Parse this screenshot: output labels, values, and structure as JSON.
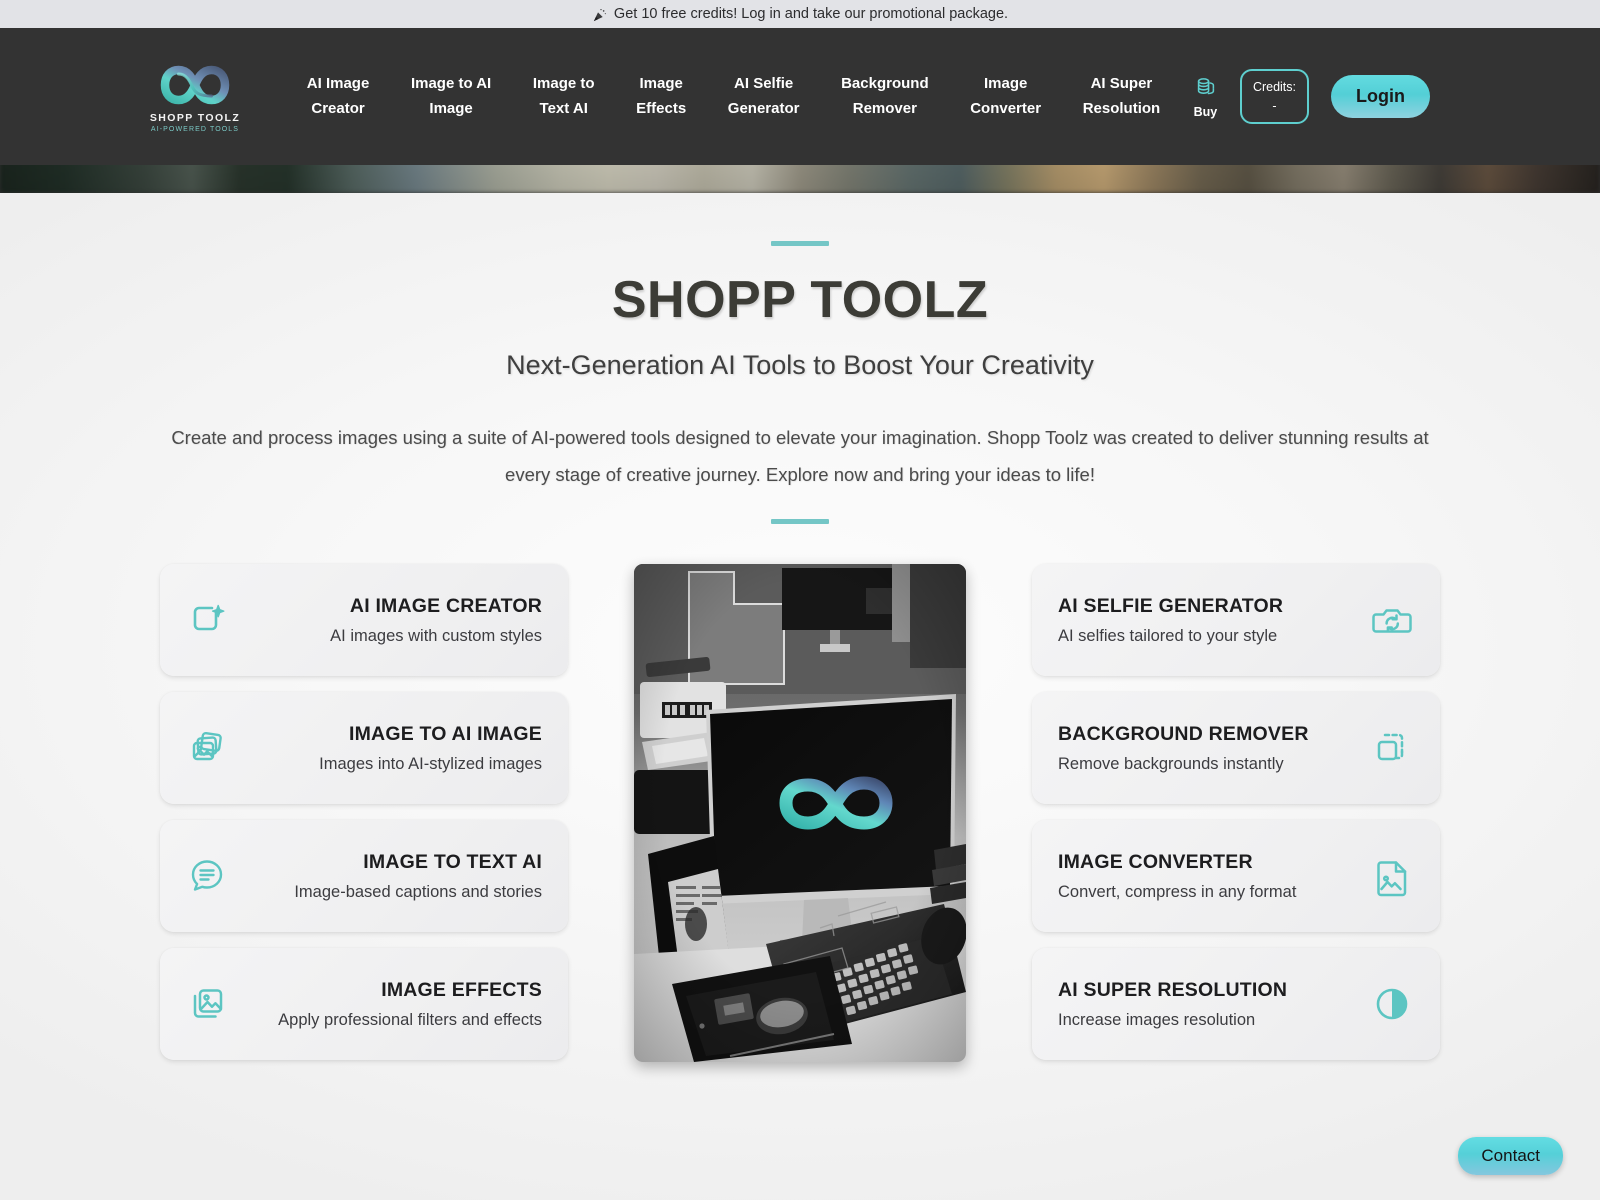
{
  "promo": {
    "icon": "party-popper-icon",
    "text": "Get 10 free credits! Log in and take our promotional package."
  },
  "brand": {
    "logo_icon": "infinity-logo-icon",
    "name": "SHOPP TOOLZ",
    "tagline": "AI-POWERED TOOLS"
  },
  "nav": {
    "links": [
      {
        "label": "AI Image\nCreator"
      },
      {
        "label": "Image to AI\nImage"
      },
      {
        "label": "Image to\nText AI"
      },
      {
        "label": "Image\nEffects"
      },
      {
        "label": "AI Selfie\nGenerator"
      },
      {
        "label": "Background\nRemover"
      },
      {
        "label": "Image\nConverter"
      },
      {
        "label": "AI Super\nResolution"
      }
    ],
    "buy": {
      "icon": "coins-icon",
      "label": "Buy"
    },
    "credits": {
      "label": "Credits:",
      "value": "-"
    },
    "login_label": "Login"
  },
  "hero": {
    "title": "SHOPP TOOLZ",
    "subtitle": "Next-Generation AI Tools to Boost Your Creativity",
    "description": "Create and process images using a suite of AI-powered tools designed to elevate your imagination. Shopp Toolz was created to deliver stunning results at every stage of creative journey. Explore now and bring your ideas to life!"
  },
  "cards": {
    "left": [
      {
        "title": "AI IMAGE CREATOR",
        "subtitle": "AI images with custom styles",
        "icon": "sparkle-frame-icon"
      },
      {
        "title": "IMAGE TO AI IMAGE",
        "subtitle": "Images into AI-stylized images",
        "icon": "stacked-photos-icon"
      },
      {
        "title": "IMAGE TO TEXT AI",
        "subtitle": "Image-based captions and stories",
        "icon": "chat-bubble-lines-icon"
      },
      {
        "title": "IMAGE EFFECTS",
        "subtitle": "Apply professional filters and effects",
        "icon": "layered-image-icon"
      }
    ],
    "right": [
      {
        "title": "AI SELFIE GENERATOR",
        "subtitle": "AI selfies tailored to your style",
        "icon": "camera-refresh-icon"
      },
      {
        "title": "BACKGROUND REMOVER",
        "subtitle": "Remove backgrounds instantly",
        "icon": "crop-cutout-icon"
      },
      {
        "title": "IMAGE CONVERTER",
        "subtitle": "Convert, compress in any format",
        "icon": "file-image-icon"
      },
      {
        "title": "AI SUPER RESOLUTION",
        "subtitle": "Increase images resolution",
        "icon": "contrast-circle-icon"
      }
    ]
  },
  "showcase": {
    "icon": "desk-workstation-photo",
    "screen_logo": "infinity-logo-icon"
  },
  "contact": {
    "label": "Contact"
  },
  "colors": {
    "accent_teal": "#5ecfcf",
    "divider_teal": "#74c6c6",
    "nav_background": "#333333",
    "promo_background": "#e2e3e7",
    "card_title": "#1d1d1f"
  }
}
